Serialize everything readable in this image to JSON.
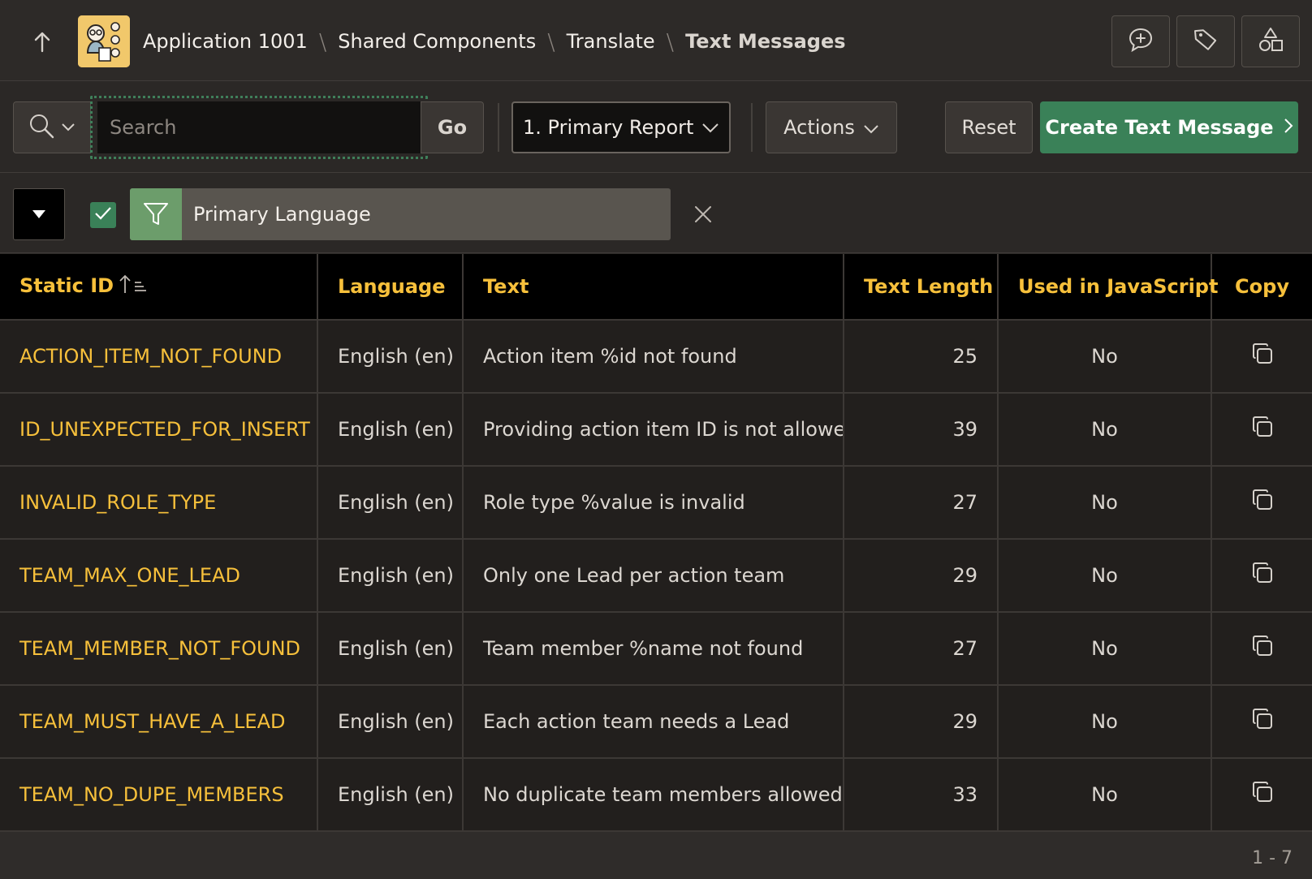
{
  "header": {
    "breadcrumb": {
      "app": "Application 1001",
      "shared": "Shared Components",
      "translate": "Translate",
      "current": "Text Messages"
    },
    "icons": [
      "arrow-up-icon",
      "feedback-icon",
      "tag-icon",
      "shapes-icon"
    ]
  },
  "toolbar": {
    "search_placeholder": "Search",
    "search_value": "",
    "go_label": "Go",
    "report_selected": "1. Primary Report",
    "actions_label": "Actions",
    "reset_label": "Reset",
    "create_label": "Create Text Message"
  },
  "filter": {
    "label": "Primary Language",
    "enabled": true
  },
  "table": {
    "columns": {
      "static_id": "Static ID",
      "language": "Language",
      "text": "Text",
      "text_length": "Text Length",
      "used_in_js": "Used in JavaScript",
      "copy": "Copy"
    },
    "rows": [
      {
        "static_id": "ACTION_ITEM_NOT_FOUND",
        "language": "English (en)",
        "text": "Action item %id not found",
        "text_length": "25",
        "used_in_js": "No"
      },
      {
        "static_id": "ID_UNEXPECTED_FOR_INSERT",
        "language": "English (en)",
        "text": "Providing action item ID is not allowed",
        "text_length": "39",
        "used_in_js": "No"
      },
      {
        "static_id": "INVALID_ROLE_TYPE",
        "language": "English (en)",
        "text": "Role type %value is invalid",
        "text_length": "27",
        "used_in_js": "No"
      },
      {
        "static_id": "TEAM_MAX_ONE_LEAD",
        "language": "English (en)",
        "text": "Only one Lead per action team",
        "text_length": "29",
        "used_in_js": "No"
      },
      {
        "static_id": "TEAM_MEMBER_NOT_FOUND",
        "language": "English (en)",
        "text": "Team member %name not found",
        "text_length": "27",
        "used_in_js": "No"
      },
      {
        "static_id": "TEAM_MUST_HAVE_A_LEAD",
        "language": "English (en)",
        "text": "Each action team needs a Lead",
        "text_length": "29",
        "used_in_js": "No"
      },
      {
        "static_id": "TEAM_NO_DUPE_MEMBERS",
        "language": "English (en)",
        "text": "No duplicate team members allowed",
        "text_length": "33",
        "used_in_js": "No"
      }
    ]
  },
  "pagination": "1 - 7",
  "colors": {
    "accent_yellow": "#f7c03b",
    "primary_green": "#3a8158",
    "filter_green": "#6c9d6b"
  }
}
